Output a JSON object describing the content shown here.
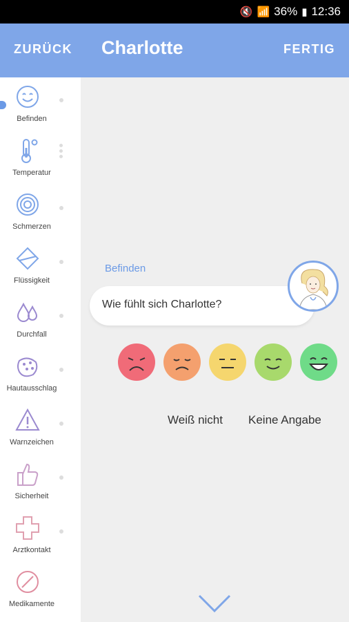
{
  "status": {
    "battery": "36%",
    "time": "12:36"
  },
  "appbar": {
    "back": "ZURÜCK",
    "title": "Charlotte",
    "done": "FERTIG"
  },
  "sidebar": {
    "items": [
      {
        "label": "Befinden",
        "icon": "smiley-icon"
      },
      {
        "label": "Temperatur",
        "icon": "thermometer-icon"
      },
      {
        "label": "Schmerzen",
        "icon": "pain-rings-icon"
      },
      {
        "label": "Flüssigkeit",
        "icon": "drop-square-icon"
      },
      {
        "label": "Durchfall",
        "icon": "drops-icon"
      },
      {
        "label": "Hautausschlag",
        "icon": "rash-icon"
      },
      {
        "label": "Warnzeichen",
        "icon": "warning-icon"
      },
      {
        "label": "Sicherheit",
        "icon": "thumbs-up-icon"
      },
      {
        "label": "Arztkontakt",
        "icon": "cross-icon"
      },
      {
        "label": "Medikamente",
        "icon": "pill-icon"
      }
    ]
  },
  "content": {
    "section": "Befinden",
    "question": "Wie fühlt sich Charlotte?",
    "options": {
      "unknown": "Weiß nicht",
      "none": "Keine Angabe"
    }
  },
  "colors": {
    "accent": "#7fa6e8",
    "face_very_bad": "#f06b78",
    "face_bad": "#f4a06e",
    "face_neutral": "#f5d66e",
    "face_good": "#a8d96c",
    "face_very_good": "#6fdb88"
  }
}
